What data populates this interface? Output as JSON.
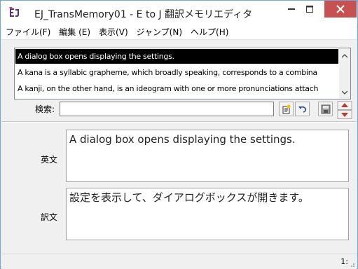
{
  "window": {
    "title": "EJ_TransMemory01 - E to J 翻訳メモリエディタ",
    "icon": "app-logo-icon"
  },
  "menu": [
    {
      "label": "ファイル(F)"
    },
    {
      "label": "編集 (E)"
    },
    {
      "label": "表示(V)"
    },
    {
      "label": "ジャンプ(N)"
    },
    {
      "label": "ヘルプ(H)"
    }
  ],
  "list": {
    "rows": [
      {
        "text": "A dialog box opens displaying the settings."
      },
      {
        "text": "A kana is a syllabic grapheme, which broadly speaking, corresponds to a combina"
      },
      {
        "text": "A kanji, on the other hand, is an ideogram with one or more pronunciations attach"
      }
    ],
    "selected_index": 0
  },
  "search": {
    "label": "検索:",
    "value": "",
    "placeholder": ""
  },
  "toolbar": {
    "buttons": [
      "add-entry-icon",
      "undo-icon",
      "save-icon"
    ]
  },
  "editor": {
    "english_label": "英文",
    "english_text": "A dialog box opens displaying the settings.",
    "japanese_label": "訳文",
    "japanese_text": "設定を表示して、ダイアログボックスが開きます。"
  },
  "status": {
    "record": "1:"
  },
  "colors": {
    "close_button": "#c75050",
    "selection": "#000000",
    "spin_arrows": "#c0392b"
  }
}
